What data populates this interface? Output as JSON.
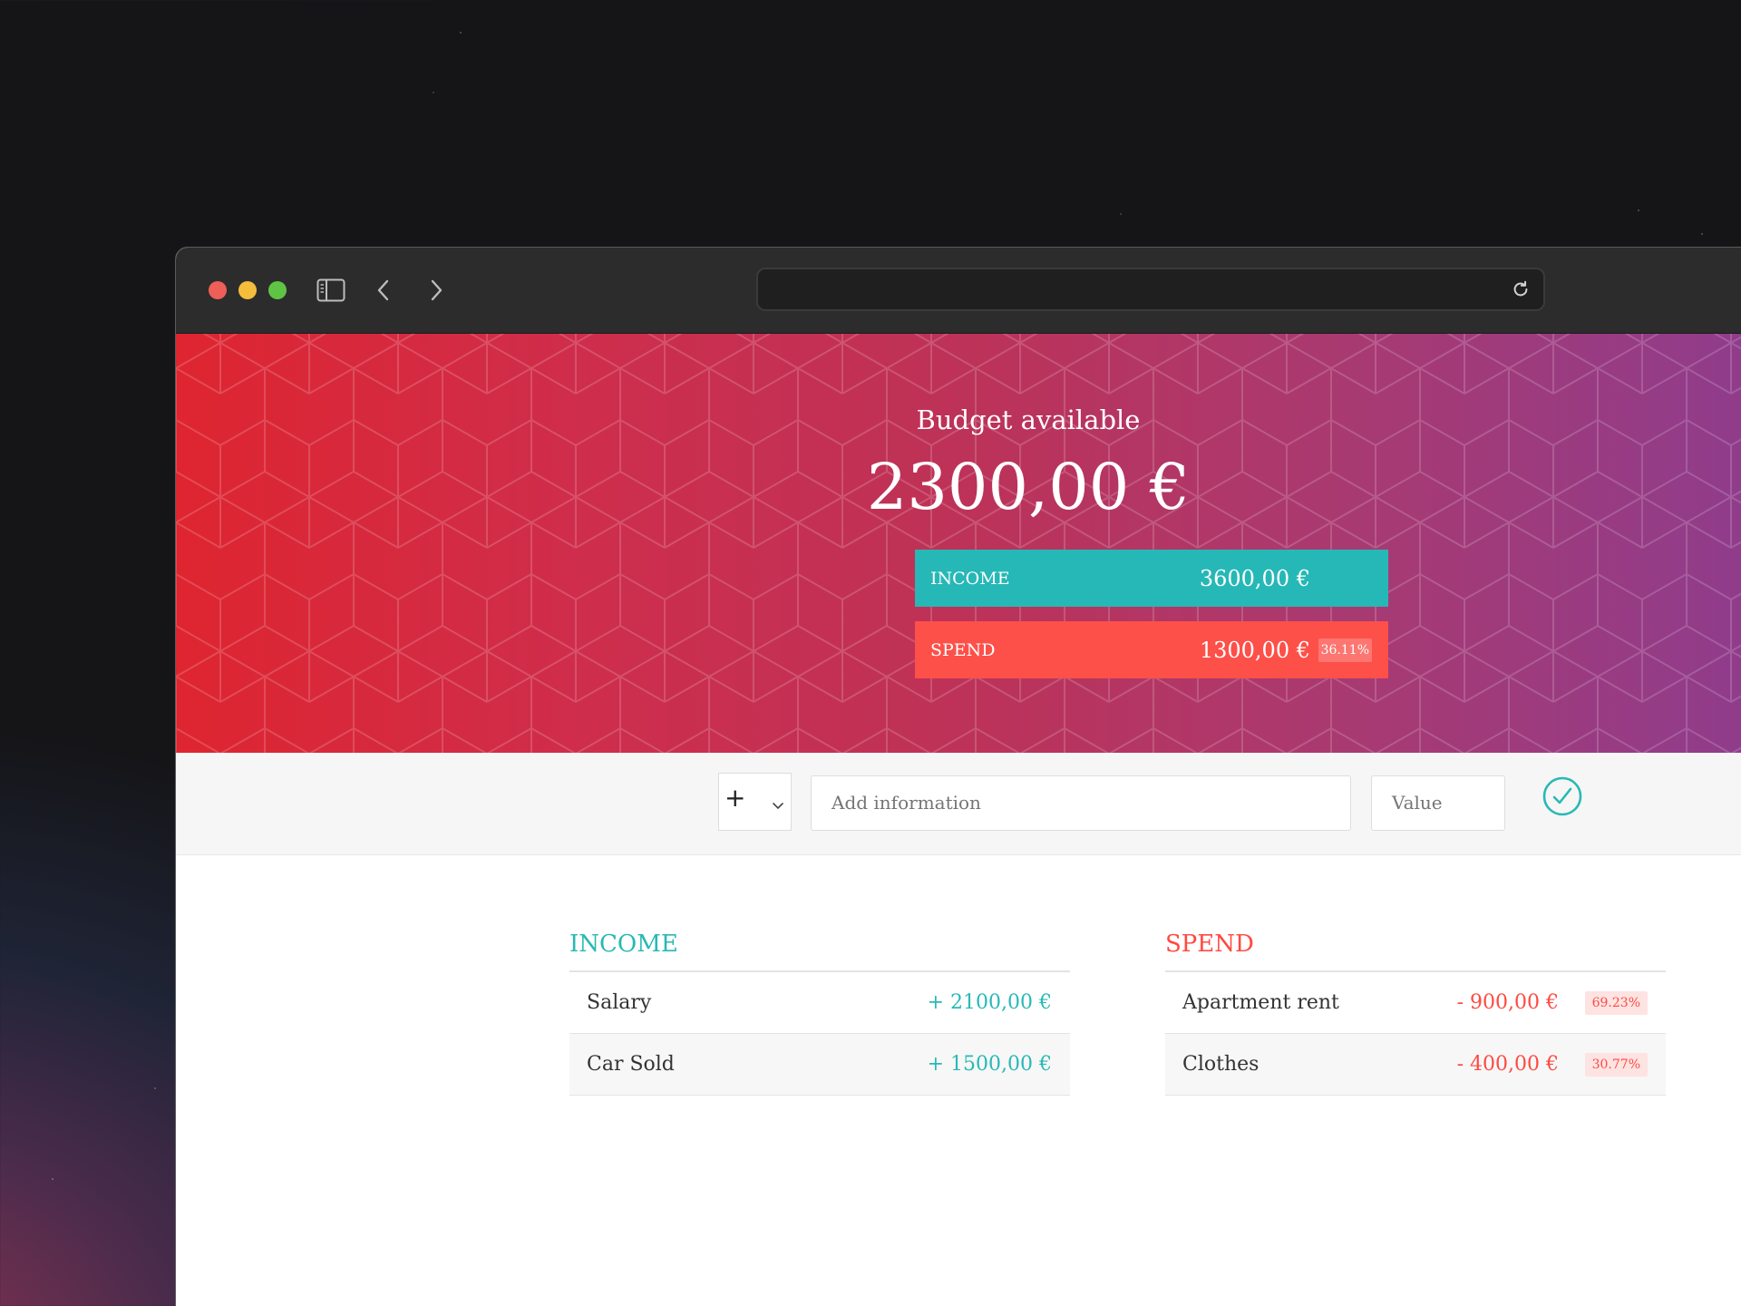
{
  "browser": {
    "url": ""
  },
  "hero": {
    "title": "Budget available",
    "amount": "2300,00 €",
    "income": {
      "label": "INCOME",
      "value": "3600,00 €"
    },
    "spend": {
      "label": "SPEND",
      "value": "1300,00 €",
      "percentage": "36.11%"
    }
  },
  "add_form": {
    "type_symbol": "+",
    "description_placeholder": "Add information",
    "value_placeholder": "Value"
  },
  "income_list": {
    "title": "INCOME",
    "items": [
      {
        "description": "Salary",
        "value": "+ 2100,00 €"
      },
      {
        "description": "Car Sold",
        "value": "+ 1500,00 €"
      }
    ]
  },
  "spend_list": {
    "title": "SPEND",
    "items": [
      {
        "description": "Apartment rent",
        "value": "- 900,00 €",
        "percentage": "69.23%"
      },
      {
        "description": "Clothes",
        "value": "- 400,00 €",
        "percentage": "30.77%"
      }
    ]
  },
  "colors": {
    "income": "#26b8b6",
    "spend": "#fd5049",
    "hero_gradient_start": "#de2530",
    "hero_gradient_end": "#8f3c8c"
  },
  "icons": {
    "sidebar": "sidebar-icon",
    "back": "chevron-left-icon",
    "forward": "chevron-right-icon",
    "reload": "reload-icon",
    "select": "chevron-down-icon",
    "submit": "check-circle-icon"
  }
}
